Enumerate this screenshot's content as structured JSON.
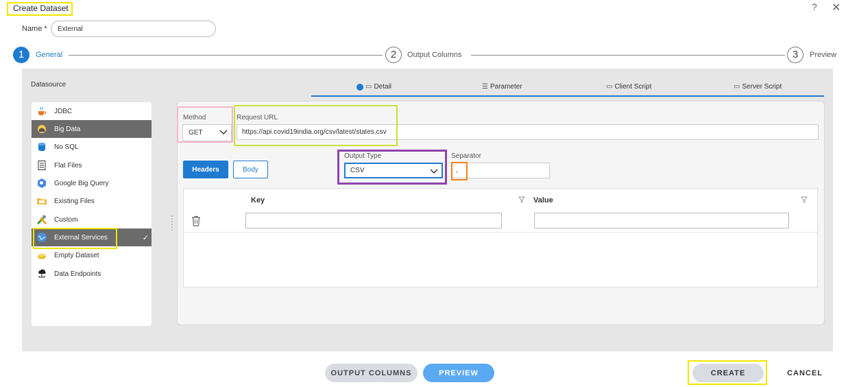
{
  "dialog": {
    "title": "Create Dataset",
    "help_icon": "?",
    "close_icon": "✕"
  },
  "name_field": {
    "label": "Name *",
    "value": "External"
  },
  "stepper": {
    "steps": [
      {
        "number": "1",
        "label": "General",
        "state": "active"
      },
      {
        "number": "2",
        "label": "Output Columns",
        "state": "pending"
      },
      {
        "number": "3",
        "label": "Preview",
        "state": "pending"
      }
    ]
  },
  "datasource": {
    "title": "Datasource",
    "items": [
      {
        "label": "JDBC",
        "icon": "coffee-cup-icon",
        "selected": false
      },
      {
        "label": "Big Data",
        "icon": "elephant-icon",
        "selected": false,
        "highlighted": true
      },
      {
        "label": "No SQL",
        "icon": "database-icon",
        "selected": false
      },
      {
        "label": "Flat Files",
        "icon": "document-icon",
        "selected": false
      },
      {
        "label": "Google Big Query",
        "icon": "bigquery-icon",
        "selected": false
      },
      {
        "label": "Existing Files",
        "icon": "folder-icon",
        "selected": false
      },
      {
        "label": "Custom",
        "icon": "tools-icon",
        "selected": false
      },
      {
        "label": "External Services",
        "icon": "globe-icon",
        "selected": true
      },
      {
        "label": "Empty Dataset",
        "icon": "empty-box-icon",
        "selected": false
      },
      {
        "label": "Data Endpoints",
        "icon": "cloud-network-icon",
        "selected": false
      }
    ]
  },
  "tabs": [
    {
      "label": "Detail",
      "icon": "detail-icon",
      "active": true
    },
    {
      "label": "Parameter",
      "icon": "sliders-icon",
      "active": false
    },
    {
      "label": "Client Script",
      "icon": "monitor-icon",
      "active": false
    },
    {
      "label": "Server Script",
      "icon": "server-script-icon",
      "active": false
    }
  ],
  "detail": {
    "method_label": "Method",
    "method_value": "GET",
    "url_label": "Request URL",
    "url_value": "https://api.covid19india.org/csv/latest/states.csv",
    "headers_button": "Headers",
    "body_button": "Body",
    "output_type_label": "Output Type",
    "output_type_value": "CSV",
    "separator_label": "Separator",
    "separator_value": ",",
    "kv_table": {
      "key_header": "Key",
      "value_header": "Value",
      "rows": [
        {
          "key": "",
          "value": ""
        }
      ]
    }
  },
  "footer": {
    "output_columns_button": "OUTPUT COLUMNS",
    "preview_button": "PREVIEW",
    "create_button": "CREATE",
    "cancel_button": "CANCEL"
  },
  "colors": {
    "accent": "#1f7bd1",
    "highlight_yellow": "#f0e600",
    "highlight_pink": "#f4b8c8",
    "highlight_green": "#c9e03a",
    "highlight_purple": "#8e44ad",
    "highlight_orange": "#f5821f"
  }
}
